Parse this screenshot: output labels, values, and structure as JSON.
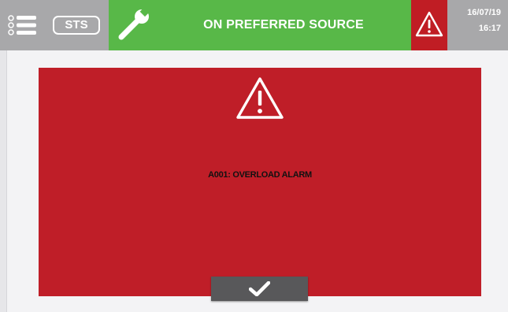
{
  "topbar": {
    "menu_icon": "list-menu-icon",
    "sts_label": "STS",
    "tool_icon": "wrench-icon",
    "status_text": "ON PREFERRED SOURCE",
    "alarm_icon": "warning-triangle-icon",
    "date": "16/07/19",
    "time": "16:17"
  },
  "alarm_dialog": {
    "icon": "warning-triangle-icon",
    "message": "A001: OVERLOAD ALARM",
    "confirm_icon": "checkmark-icon"
  },
  "colors": {
    "topbar_gray": "#a8a8aa",
    "status_green": "#58b848",
    "alarm_red": "#bf1e28",
    "button_dark": "#58585a",
    "background": "#f3f3f5"
  }
}
